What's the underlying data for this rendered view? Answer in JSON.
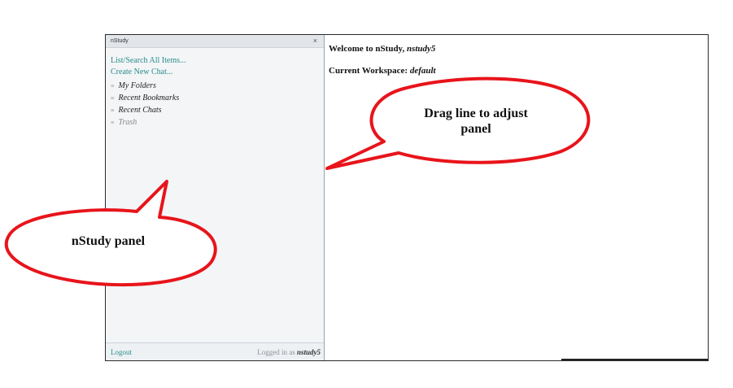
{
  "panel": {
    "title": "nStudy",
    "close_glyph": "×",
    "links": [
      "List/Search All Items...",
      "Create New Chat..."
    ],
    "tree_items": [
      {
        "label": "My Folders",
        "muted": false
      },
      {
        "label": "Recent Bookmarks",
        "muted": false
      },
      {
        "label": "Recent Chats",
        "muted": false
      },
      {
        "label": "Trash",
        "muted": true
      }
    ],
    "footer": {
      "logout": "Logout",
      "logged_in_prefix": "Logged in as",
      "username": "nstudy5"
    }
  },
  "main": {
    "welcome_prefix": "Welcome to nStudy,",
    "welcome_user": "nstudy5",
    "workspace_prefix": "Current Workspace:",
    "workspace_value": "default"
  },
  "callouts": {
    "drag_line_1": "Drag line to adjust",
    "drag_line_2": "panel",
    "panel_label": "nStudy panel"
  },
  "colors": {
    "callout_stroke": "#e8141b",
    "link": "#2a8c8a"
  }
}
